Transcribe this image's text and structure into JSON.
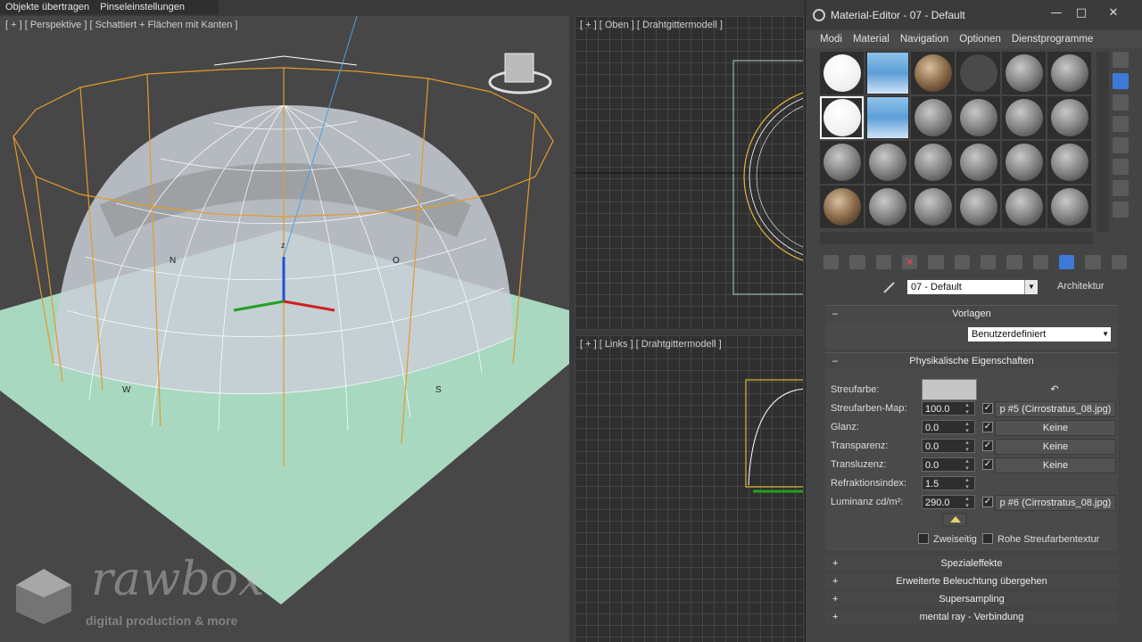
{
  "topbar": {
    "items": [
      "Objekte übertragen",
      "Pinseleinstellungen"
    ]
  },
  "viewports": {
    "perspective_label": "[ + ] [ Perspektive ] [ Schattiert + Flächen mit Kanten ]",
    "top_label": "[ + ] [ Oben ] [ Drahtgittermodell ]",
    "left_label": "[ + ] [ Links ] [ Drahtgittermodell ]",
    "compass": {
      "n": "N",
      "o": "O",
      "w": "W",
      "s": "S",
      "z": "z"
    }
  },
  "watermark": {
    "brand": "rawbox",
    "tagline": "digital production & more"
  },
  "material_editor": {
    "title": "Material-Editor - 07 - Default",
    "window_buttons": {
      "minimize": "—",
      "maximize": "□",
      "close": "✕"
    },
    "menu": [
      "Modi",
      "Material",
      "Navigation",
      "Optionen",
      "Dienstprogramme"
    ],
    "slots": [
      "white",
      "sky",
      "brown",
      "dark",
      "grey",
      "grey",
      "white",
      "sky",
      "grey",
      "grey",
      "grey",
      "grey",
      "grey",
      "grey",
      "grey",
      "grey",
      "grey",
      "grey",
      "brown",
      "grey",
      "grey",
      "grey",
      "grey",
      "grey"
    ],
    "material_name": "07 - Default",
    "material_type": "Architektur",
    "templates": {
      "header": "Vorlagen",
      "value": "Benutzerdefiniert"
    },
    "physical": {
      "header": "Physikalische Eigenschaften",
      "rows": [
        {
          "label": "Streufarbe:"
        },
        {
          "label": "Streufarben-Map:",
          "value": "100.0",
          "map": "p #5 (Cirrostratus_08.jpg)"
        },
        {
          "label": "Glanz:",
          "value": "0.0",
          "map": "Keine"
        },
        {
          "label": "Transparenz:",
          "value": "0.0",
          "map": "Keine"
        },
        {
          "label": "Transluzenz:",
          "value": "0.0",
          "map": "Keine"
        },
        {
          "label": "Refraktionsindex:",
          "value": "1.5"
        },
        {
          "label": "Luminanz cd/m²:",
          "value": "290.0",
          "map": "p #6 (Cirrostratus_08.jpg)"
        }
      ],
      "two_sided": "Zweiseitig",
      "raw_diffuse": "Rohe Streufarbentextur"
    },
    "collapsed_rollouts": [
      "Spezialeffekte",
      "Erweiterte Beleuchtung übergehen",
      "Supersampling",
      "mental ray - Verbindung"
    ],
    "check": "✓",
    "plus": "+",
    "minus": "–"
  }
}
